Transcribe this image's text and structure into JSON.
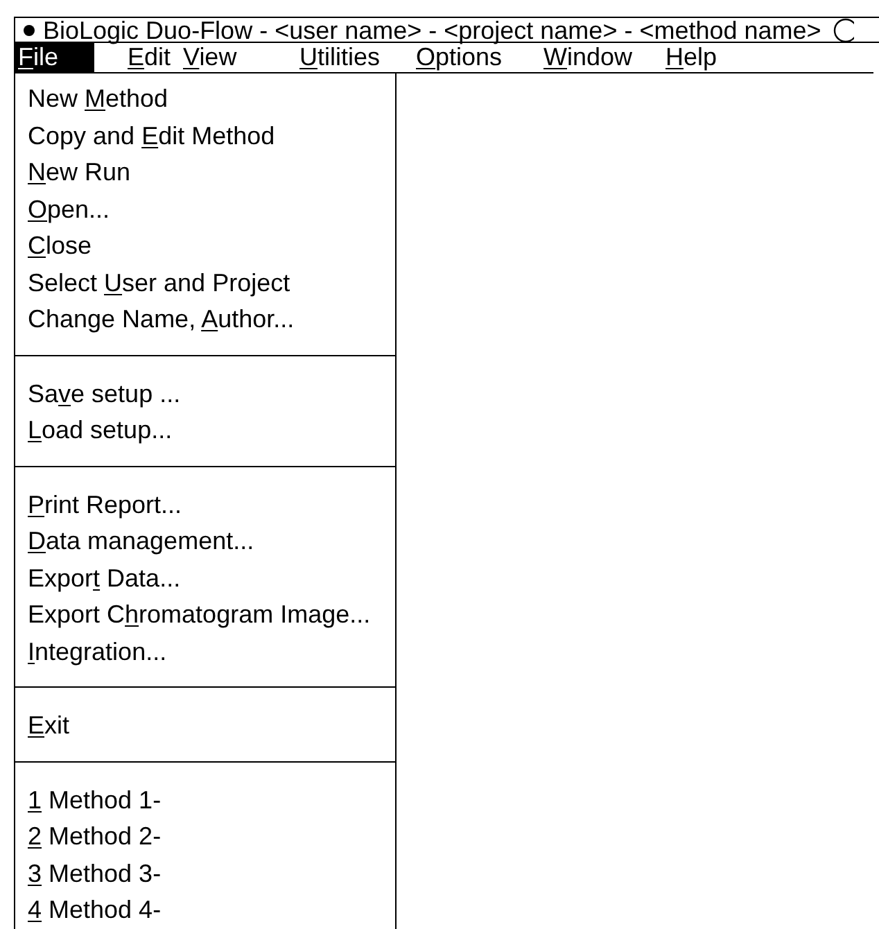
{
  "window": {
    "title": "BioLogic Duo-Flow - <user name> - <project name> - <method name>"
  },
  "menu_bar": [
    {
      "key": "F",
      "after": "ile",
      "selected": true
    },
    {
      "key": "E",
      "after": "dit",
      "selected": false
    },
    {
      "key": "V",
      "after": "iew",
      "selected": false
    },
    {
      "key": "U",
      "after": "tilities",
      "selected": false
    },
    {
      "key": "O",
      "after": "ptions",
      "selected": false
    },
    {
      "key": "W",
      "after": "indow",
      "selected": false
    },
    {
      "key": "H",
      "after": "elp",
      "selected": false
    }
  ],
  "file_menu": [
    [
      {
        "before": "New ",
        "key": "M",
        "after": "ethod"
      },
      {
        "before": "Copy and ",
        "key": "E",
        "after": "dit Method"
      },
      {
        "key": "N",
        "after": "ew Run"
      },
      {
        "key": "O",
        "after": "pen..."
      },
      {
        "key": "C",
        "after": "lose"
      },
      {
        "before": "Select ",
        "key": "U",
        "after": "ser and Project"
      },
      {
        "before": "Change Name, ",
        "key": "A",
        "after": "uthor..."
      }
    ],
    [
      {
        "before": "Sa",
        "key": "v",
        "after": "e setup ..."
      },
      {
        "key": "L",
        "after": "oad setup..."
      }
    ],
    [
      {
        "key": "P",
        "after": "rint Report..."
      },
      {
        "key": "D",
        "after": "ata management..."
      },
      {
        "before": "Expor",
        "key": "t",
        "after": " Data..."
      },
      {
        "before": "Export C",
        "key": "h",
        "after": "romatogram Image..."
      },
      {
        "key": "I",
        "after": "ntegration..."
      }
    ],
    [
      {
        "key": "E",
        "after": "xit"
      }
    ],
    [
      {
        "key": "1",
        "after": " Method 1-"
      },
      {
        "key": "2",
        "after": " Method 2-"
      },
      {
        "key": "3",
        "after": " Method 3-"
      },
      {
        "key": "4",
        "after": " Method 4-"
      }
    ]
  ]
}
